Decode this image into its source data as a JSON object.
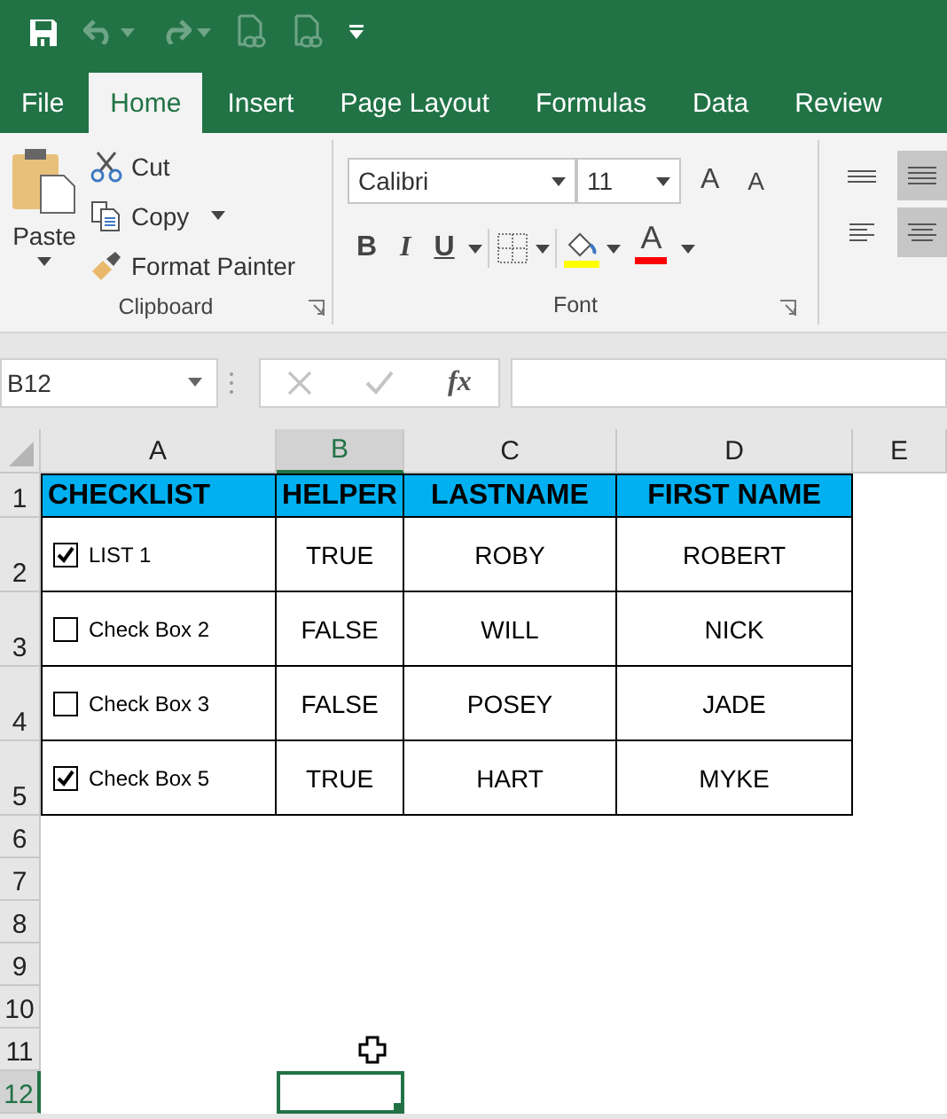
{
  "quick_access": [
    {
      "kind": "save",
      "disabled": false
    },
    {
      "kind": "undo",
      "disabled": true
    },
    {
      "kind": "redo",
      "disabled": true
    },
    {
      "kind": "link_doc",
      "disabled": true
    },
    {
      "kind": "link_doc",
      "disabled": true
    },
    {
      "kind": "customize",
      "disabled": false
    }
  ],
  "tabs": [
    {
      "label": "File",
      "selected": false
    },
    {
      "label": "Home",
      "selected": true
    },
    {
      "label": "Insert",
      "selected": false
    },
    {
      "label": "Page Layout",
      "selected": false
    },
    {
      "label": "Formulas",
      "selected": false
    },
    {
      "label": "Data",
      "selected": false
    },
    {
      "label": "Review",
      "selected": false
    }
  ],
  "clipboard": {
    "label": "Clipboard",
    "paste": "Paste",
    "buttons": [
      {
        "kind": "cut",
        "label": "Cut",
        "dropdown": false
      },
      {
        "kind": "copy",
        "label": "Copy",
        "dropdown": true
      },
      {
        "kind": "format_painter",
        "label": "Format Painter",
        "dropdown": false
      }
    ]
  },
  "font": {
    "label": "Font",
    "font_name": "Calibri",
    "font_size": "11",
    "grow": "A",
    "shrink": "A",
    "styles": [
      {
        "kind": "bold",
        "glyph": "B"
      },
      {
        "kind": "italic",
        "glyph": "I"
      },
      {
        "kind": "underline",
        "glyph": "U"
      }
    ],
    "font_color_glyph": "A"
  },
  "alignment": [
    {
      "kind": "top",
      "selected": false
    },
    {
      "kind": "middle",
      "selected": true
    },
    {
      "kind": "left",
      "selected": false
    },
    {
      "kind": "center",
      "selected": true
    }
  ],
  "formula_bar": {
    "name_box": "B12",
    "function_label": "fx"
  },
  "sheet": {
    "columns": [
      {
        "label": "A",
        "selected": false
      },
      {
        "label": "B",
        "selected": true
      },
      {
        "label": "C",
        "selected": false
      },
      {
        "label": "D",
        "selected": false
      },
      {
        "label": "E",
        "selected": false
      }
    ],
    "rows": [
      {
        "number": "1",
        "selected": false,
        "kind": "header",
        "cells": [
          "CHECKLIST",
          "HELPER",
          "LASTNAME",
          "FIRST NAME"
        ]
      },
      {
        "number": "2",
        "selected": false,
        "kind": "data",
        "checkbox": {
          "label": "LIST 1",
          "checked": true
        },
        "cells": [
          "TRUE",
          "ROBY",
          "ROBERT"
        ]
      },
      {
        "number": "3",
        "selected": false,
        "kind": "data",
        "checkbox": {
          "label": "Check Box 2",
          "checked": false
        },
        "cells": [
          "FALSE",
          "WILL",
          "NICK"
        ]
      },
      {
        "number": "4",
        "selected": false,
        "kind": "data",
        "checkbox": {
          "label": "Check Box 3",
          "checked": false
        },
        "cells": [
          "FALSE",
          "POSEY",
          "JADE"
        ]
      },
      {
        "number": "5",
        "selected": false,
        "kind": "data",
        "checkbox": {
          "label": "Check Box 5",
          "checked": true
        },
        "cells": [
          "TRUE",
          "HART",
          "MYKE"
        ]
      },
      {
        "number": "6",
        "selected": false,
        "kind": "empty"
      },
      {
        "number": "7",
        "selected": false,
        "kind": "empty"
      },
      {
        "number": "8",
        "selected": false,
        "kind": "empty"
      },
      {
        "number": "9",
        "selected": false,
        "kind": "empty"
      },
      {
        "number": "10",
        "selected": false,
        "kind": "empty"
      },
      {
        "number": "11",
        "selected": false,
        "kind": "empty"
      },
      {
        "number": "12",
        "selected": true,
        "kind": "empty"
      }
    ]
  }
}
